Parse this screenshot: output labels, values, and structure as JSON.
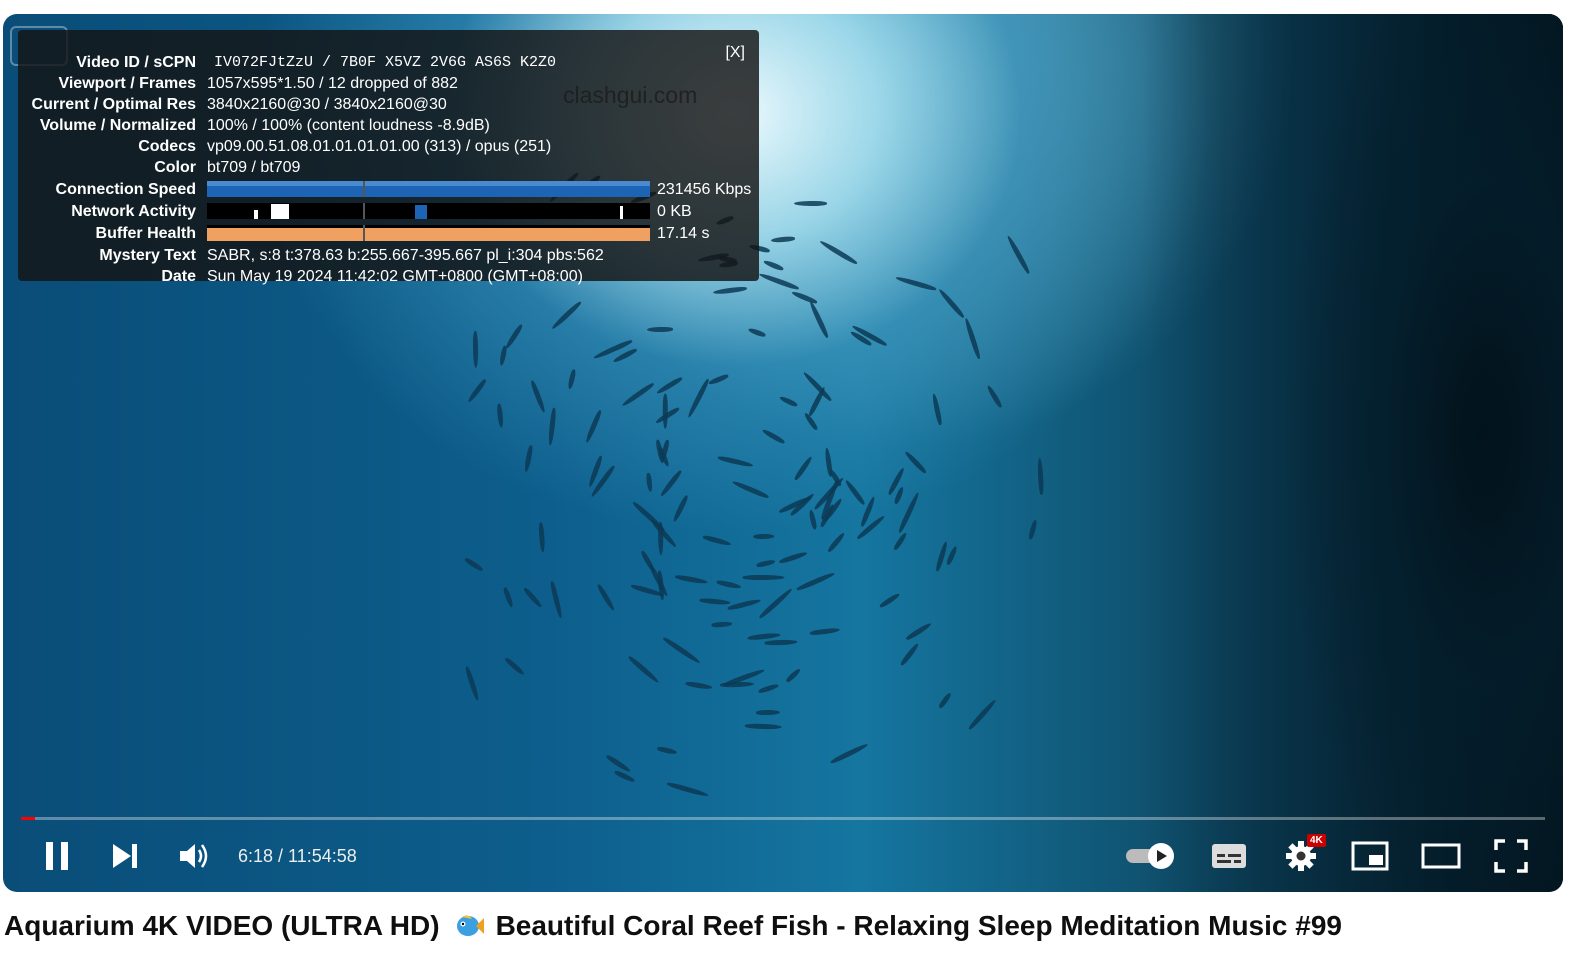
{
  "stats": {
    "close_label": "[X]",
    "watermark": "clashgui.com",
    "rows": [
      {
        "label": "Video ID / sCPN",
        "value": "IV072FJtZzU / 7B0F X5VZ 2V6G AS6S K2Z0"
      },
      {
        "label": "Viewport / Frames",
        "value": "1057x595*1.50 / 12 dropped of 882"
      },
      {
        "label": "Current / Optimal Res",
        "value": "3840x2160@30 / 3840x2160@30"
      },
      {
        "label": "Volume / Normalized",
        "value": "100% / 100% (content loudness -8.9dB)"
      },
      {
        "label": "Codecs",
        "value": "vp09.00.51.08.01.01.01.01.00 (313) / opus (251)"
      },
      {
        "label": "Color",
        "value": "bt709 / bt709"
      },
      {
        "label": "Connection Speed",
        "value": "231456 Kbps"
      },
      {
        "label": "Network Activity",
        "value": "0 KB"
      },
      {
        "label": "Buffer Health",
        "value": "17.14 s"
      },
      {
        "label": "Mystery Text",
        "value": "SABR, s:8 t:378.63 b:255.667-395.667 pl_i:304 pbs:562"
      },
      {
        "label": "Date",
        "value": "Sun May 19 2024 11:42:02 GMT+0800 (GMT+08:00)"
      }
    ]
  },
  "player": {
    "time_display": "6:18 / 11:54:58",
    "progress_fraction": 0.009,
    "settings_badge": "4K",
    "colors": {
      "progress": "#ff0000",
      "graph_connection": "#1e64b4",
      "graph_buffer": "#f0a060"
    }
  },
  "video": {
    "title_part1": "Aquarium 4K VIDEO (ULTRA HD)",
    "title_part2": "Beautiful Coral Reef Fish - Relaxing Sleep Meditation Music #99"
  },
  "icons": [
    "pause-icon",
    "next-icon",
    "volume-icon",
    "autoplay-toggle-icon",
    "subtitles-icon",
    "settings-icon",
    "miniplayer-icon",
    "theater-mode-icon",
    "fullscreen-icon",
    "fish-emoji-icon"
  ]
}
